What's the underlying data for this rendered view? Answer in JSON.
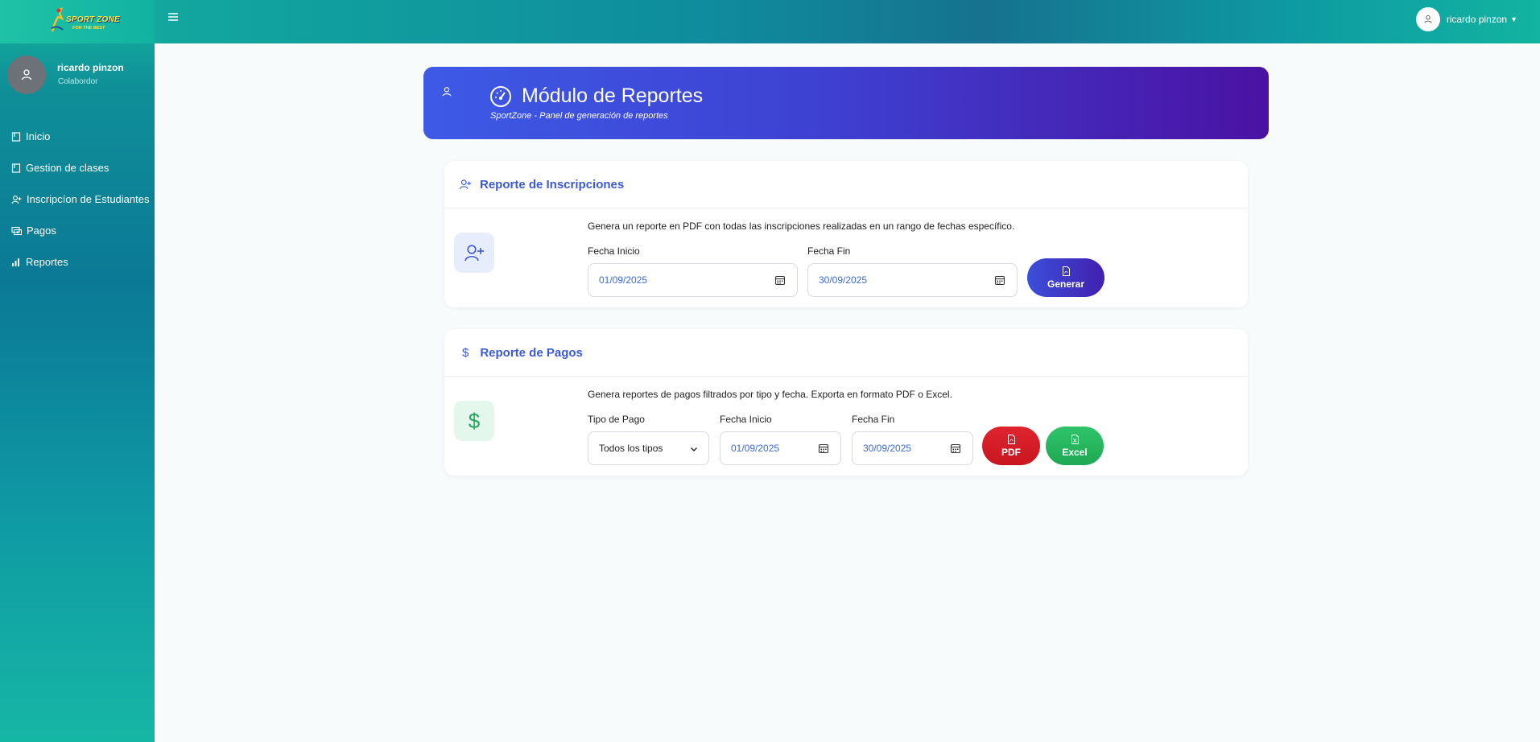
{
  "logo": {
    "line1": "SPORT ZONE",
    "line2": "FOR THE BEST"
  },
  "sidebar": {
    "user_name": "ricardo pinzon",
    "user_role": "Colabordor",
    "items": [
      {
        "label": "Inicio",
        "icon": "book-icon"
      },
      {
        "label": "Gestion de clases",
        "icon": "book-icon"
      },
      {
        "label": "Inscripcíon de Estudiantes",
        "icon": "user-plus-icon"
      },
      {
        "label": "Pagos",
        "icon": "money-icon"
      },
      {
        "label": "Reportes",
        "icon": "bar-chart-icon"
      }
    ]
  },
  "topbar": {
    "user_name": "ricardo pinzon"
  },
  "header": {
    "title": "Módulo de Reportes",
    "subtitle": "SportZone - Panel de generación de reportes"
  },
  "inscripciones": {
    "title": "Reporte de Inscripciones",
    "description": "Genera un reporte en PDF con todas las inscripciones realizadas en un rango de fechas específico.",
    "fecha_inicio_label": "Fecha Inicio",
    "fecha_inicio_value": "01/09/2025",
    "fecha_fin_label": "Fecha Fin",
    "fecha_fin_value": "30/09/2025",
    "button": "Generar"
  },
  "pagos": {
    "title": "Reporte de Pagos",
    "description": "Genera reportes de pagos filtrados por tipo y fecha. Exporta en formato PDF o Excel.",
    "tipo_label": "Tipo de Pago",
    "tipo_value": "Todos los tipos",
    "fecha_inicio_label": "Fecha Inicio",
    "fecha_inicio_value": "01/09/2025",
    "fecha_fin_label": "Fecha Fin",
    "fecha_fin_value": "30/09/2025",
    "pdf_button": "PDF",
    "excel_button": "Excel"
  },
  "colors": {
    "primary": "#3b5ad6",
    "pdf": "#dc2626",
    "excel": "#22b55e",
    "sidebar": "#0b7996"
  }
}
